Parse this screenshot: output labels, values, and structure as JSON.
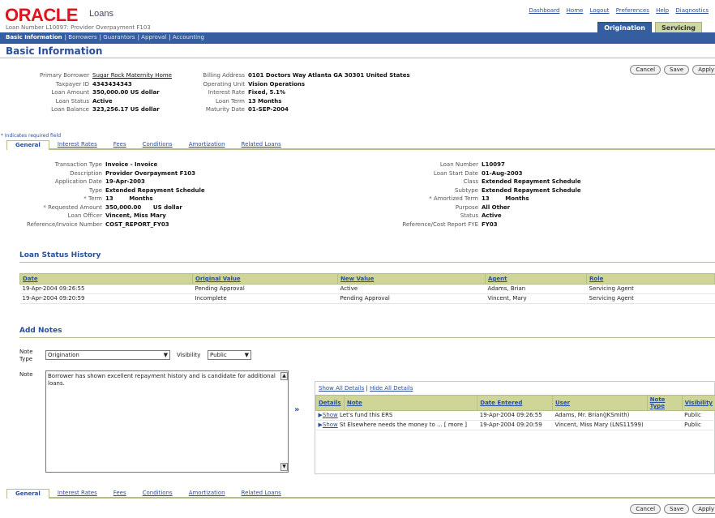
{
  "header": {
    "logo_text": "ORACLE",
    "app_name": "Loans",
    "subheading": "Loan Number L10097: Provider Overpayment F103",
    "global_links": [
      "Dashboard",
      "Home",
      "Logout",
      "Preferences",
      "Help",
      "Diagnostics"
    ],
    "tabs": [
      "Origination",
      "Servicing"
    ]
  },
  "nav": {
    "items": [
      "Basic Information",
      "Borrowers",
      "Guarantors",
      "Approval",
      "Accounting"
    ]
  },
  "page": {
    "title": "Basic Information"
  },
  "buttons_top": [
    "Cancel",
    "Save",
    "Apply"
  ],
  "buttons_bottom": [
    "Cancel",
    "Save",
    "Apply"
  ],
  "summary": {
    "left": [
      {
        "k": "Primary Borrower",
        "v": "Sugar Rock Maternity Home",
        "link": true
      },
      {
        "k": "Taxpayer ID",
        "v": "4343434343"
      },
      {
        "k": "Loan Amount",
        "v": "350,000.00 US dollar"
      },
      {
        "k": "Loan Status",
        "v": "Active"
      },
      {
        "k": "Loan Balance",
        "v": "323,256.17 US dollar"
      }
    ],
    "right": [
      {
        "k": "Billing Address",
        "v": "0101 Doctors Way Atlanta GA 30301 United States"
      },
      {
        "k": "Operating Unit",
        "v": "Vision Operations"
      },
      {
        "k": "Interest Rate",
        "v": "Fixed, 5.1%"
      },
      {
        "k": "Loan Term",
        "v": "13 Months"
      },
      {
        "k": "Maturity Date",
        "v": "01-SEP-2004"
      }
    ]
  },
  "required_note": "* Indicates required field",
  "subtabs": [
    "General",
    "Interest Rates",
    "Fees",
    "Conditions",
    "Amortization",
    "Related Loans"
  ],
  "details": {
    "left": [
      {
        "k": "Transaction Type",
        "v": "Invoice - Invoice"
      },
      {
        "k": "Description",
        "v": "Provider Overpayment F103"
      },
      {
        "k": "Application Date",
        "v": "19-Apr-2003"
      },
      {
        "k": "Type",
        "v": "Extended Repayment Schedule"
      },
      {
        "k": "* Term",
        "v": "13        Months"
      },
      {
        "k": "* Requested Amount",
        "v": "350,000.00      US dollar"
      },
      {
        "k": "Loan Officer",
        "v": "Vincent, Miss Mary"
      },
      {
        "k": "Reference/Invoice Number",
        "v": "COST_REPORT_FY03"
      }
    ],
    "right": [
      {
        "k": "Loan Number",
        "v": "L10097"
      },
      {
        "k": "Loan Start Date",
        "v": "01-Aug-2003"
      },
      {
        "k": "Class",
        "v": "Extended Repayment Schedule"
      },
      {
        "k": "Subtype",
        "v": "Extended Repayment Schedule"
      },
      {
        "k": "* Amortized Term",
        "v": "13        Months"
      },
      {
        "k": "Purpose",
        "v": "All Other"
      },
      {
        "k": "Status",
        "v": "Active"
      },
      {
        "k": "Reference/Cost Report FYE",
        "v": "FY03"
      }
    ]
  },
  "status_history": {
    "title": "Loan Status History",
    "columns": [
      "Date",
      "Original Value",
      "New Value",
      "Agent",
      "Role"
    ],
    "rows": [
      [
        "19-Apr-2004 09:26:55",
        "Pending Approval",
        "Active",
        "Adams, Brian",
        "Servicing Agent"
      ],
      [
        "19-Apr-2004 09:20:59",
        "Incomplete",
        "Pending Approval",
        "Vincent, Mary",
        "Servicing Agent"
      ]
    ]
  },
  "notes": {
    "title": "Add Notes",
    "note_type_label": "Note Type",
    "note_type_value": "Origination",
    "visibility_label": "Visibility",
    "visibility_value": "Public",
    "note_label": "Note",
    "note_text": "Borrower has shown excellent repayment history and is candidate for additional loans.",
    "move_arrow": "»",
    "show_all": "Show All Details",
    "hide_all": "Hide All Details",
    "separator": "|",
    "columns": [
      "Details",
      "Note",
      "Date Entered",
      "User",
      "Note Type",
      "Visibility"
    ],
    "rows": [
      {
        "show": "Show",
        "note": "Let's fund this ERS",
        "date": "19-Apr-2004 09:26:55",
        "user": "Adams, Mr. Brian(JKSmith)",
        "type": "",
        "vis": "Public"
      },
      {
        "show": "Show",
        "note": "St Elsewhere needs the money to ... [ more ]",
        "date": "19-Apr-2004 09:20:59",
        "user": "Vincent, Miss Mary (LNS11599)",
        "type": "",
        "vis": "Public"
      }
    ]
  }
}
